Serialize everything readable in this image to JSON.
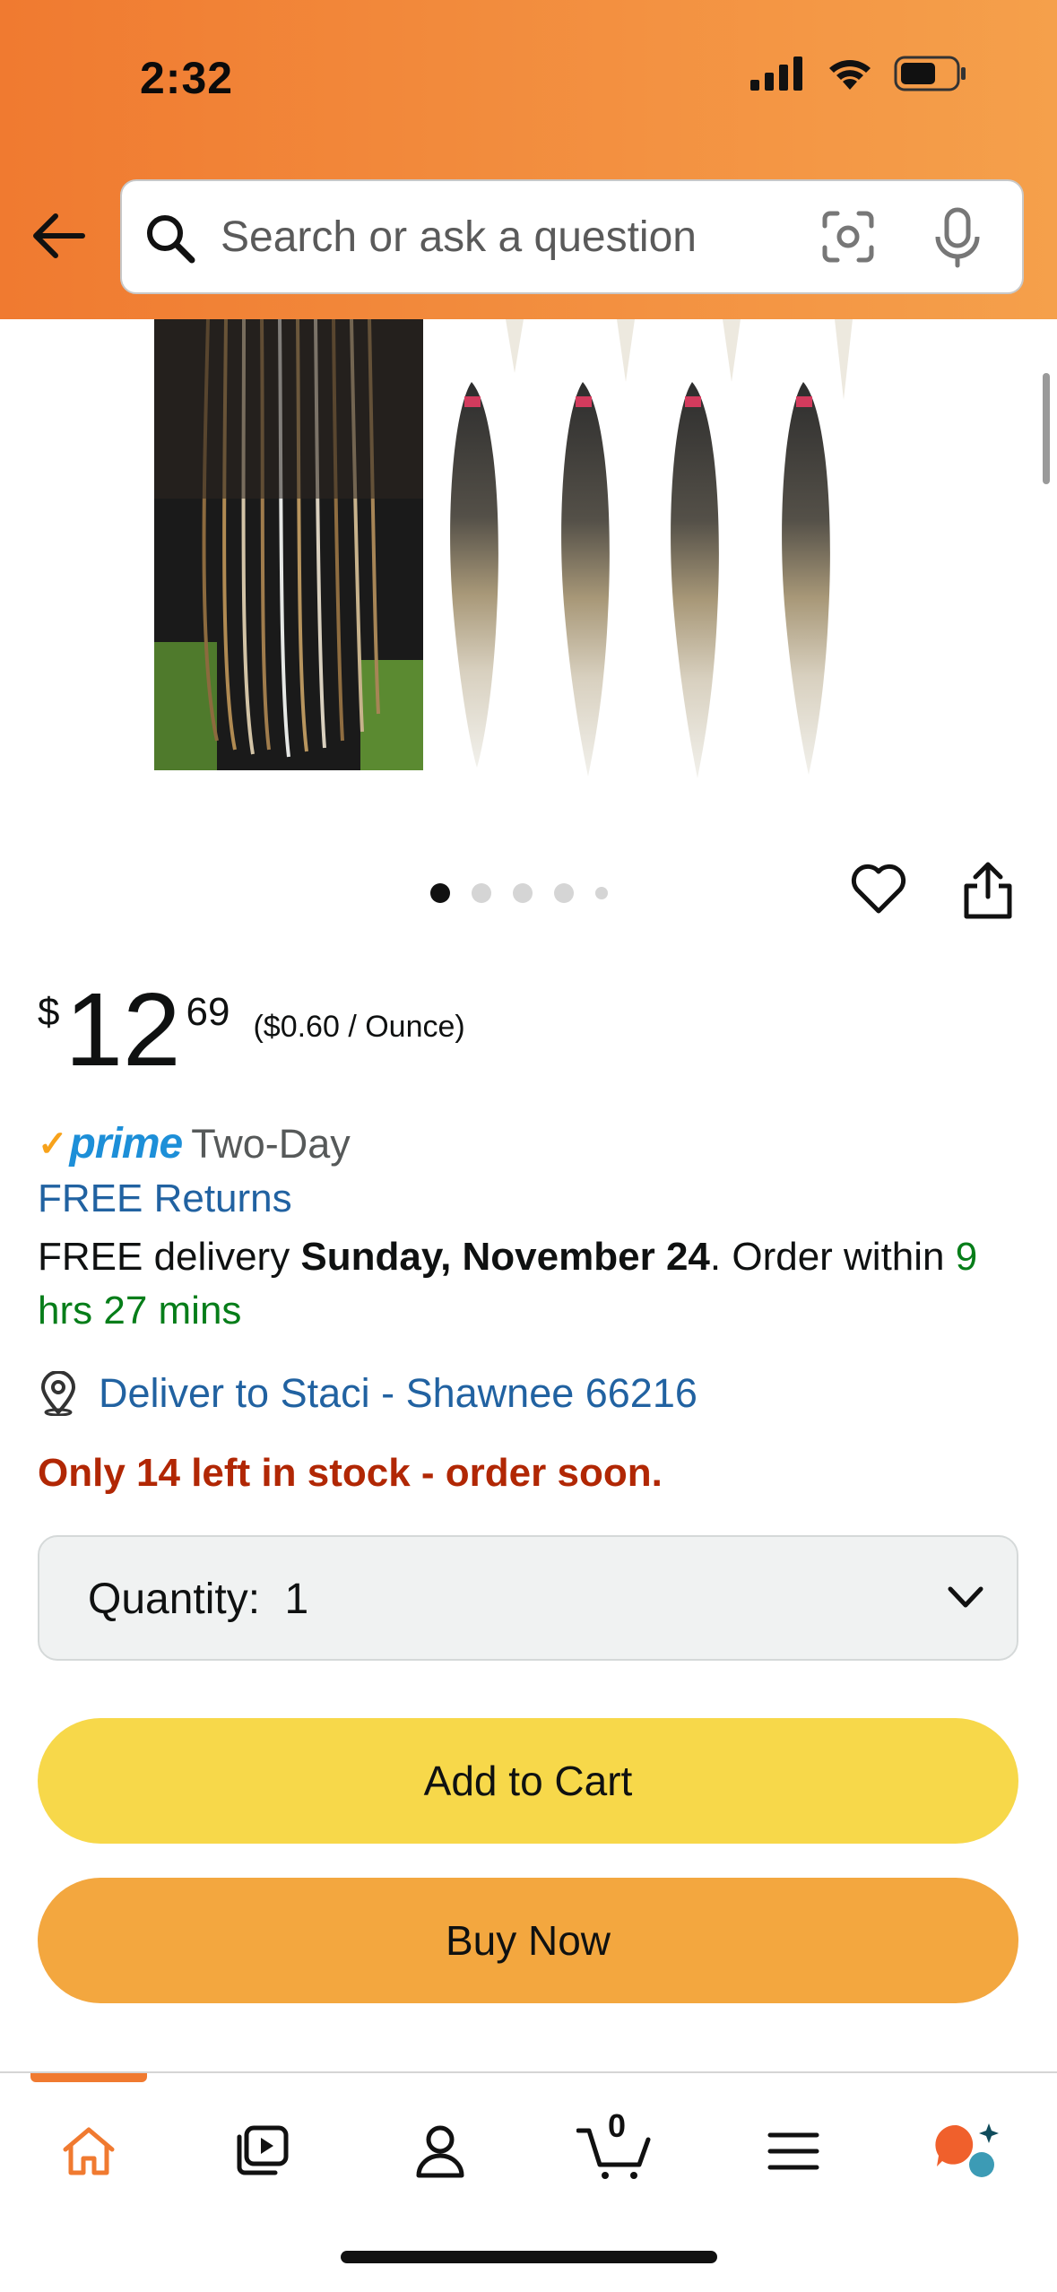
{
  "status_bar": {
    "time": "2:32"
  },
  "search": {
    "placeholder": "Search or ask a question"
  },
  "gallery": {
    "dots_count": 5,
    "active_dot": 0
  },
  "price": {
    "currency": "$",
    "whole": "12",
    "fraction": "69",
    "unit_price": "($0.60 / Ounce)"
  },
  "prime": {
    "word": "prime",
    "speed": "Two-Day"
  },
  "returns": {
    "label": "FREE Returns"
  },
  "delivery": {
    "prefix": "FREE delivery ",
    "date": "Sunday, November 24",
    "middle": ". Order within ",
    "countdown": "9 hrs 27 mins"
  },
  "deliver_to": {
    "label": "Deliver to Staci - Shawnee 66216"
  },
  "stock": {
    "label": "Only 14 left in stock - order soon."
  },
  "quantity": {
    "label": "Quantity:",
    "value": "1"
  },
  "buttons": {
    "add_to_cart": "Add to Cart",
    "buy_now": "Buy Now"
  },
  "bottom_nav": {
    "cart_count": "0",
    "items": [
      "home-icon",
      "video-icon",
      "account-icon",
      "cart-icon",
      "menu-icon",
      "rufus-ai-icon"
    ]
  },
  "colors": {
    "header_start": "#f07a30",
    "header_end": "#f5a04b",
    "add_to_cart": "#f7d84a",
    "buy_now": "#f3a73f",
    "link": "#2162a1",
    "stock": "#b12704",
    "green": "#067d19",
    "prime": "#1d8fd8"
  }
}
